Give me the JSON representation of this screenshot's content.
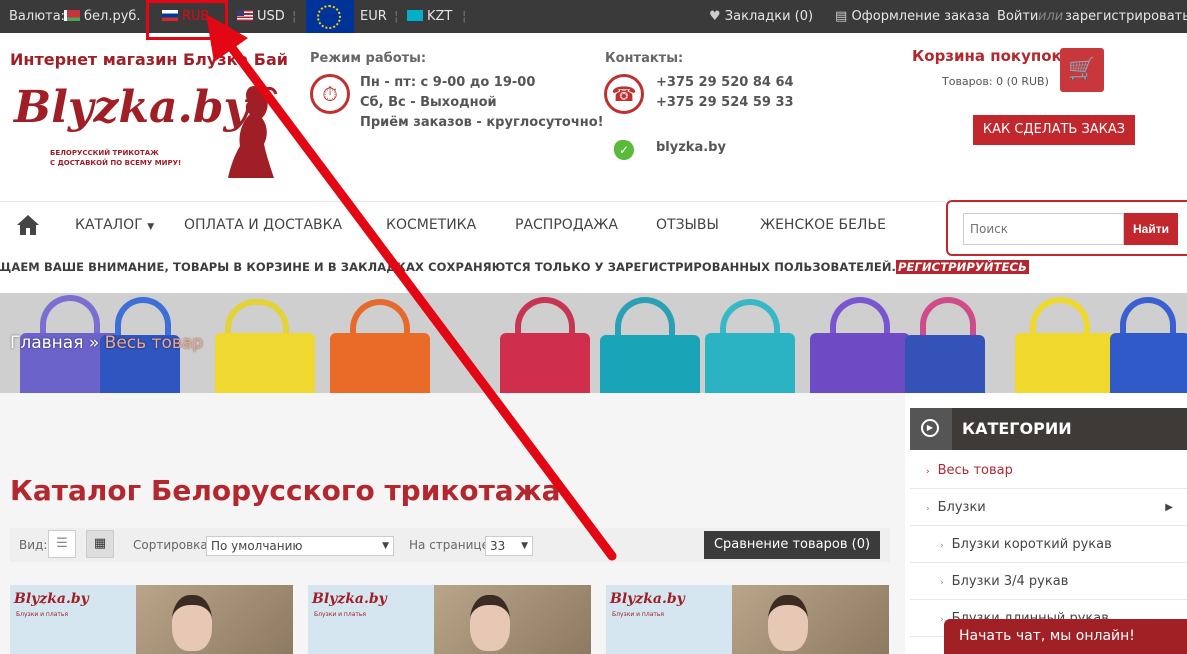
{
  "topbar": {
    "currency_label": "Валюта:",
    "currencies": [
      "бел.руб.",
      "RUB",
      "USD",
      "EUR",
      "KZT"
    ],
    "bookmarks": "Закладки (0)",
    "checkout": "Оформление заказа",
    "login": "Войти",
    "or": "или",
    "register": "зарегистрироваться"
  },
  "header": {
    "shop_name": "Интернет магазин Блузка Бай",
    "logo_text": "Blyzka.by",
    "logo_tagline_1": "БЕЛОРУССКИЙ ТРИКОТАЖ",
    "logo_tagline_2": "С ДОСТАВКОЙ ПО ВСЕМУ МИРУ!",
    "hours_title": "Режим работы:",
    "hours_lines": [
      "Пн - пт: с 9-00 до 19-00",
      "Сб, Вс - Выходной",
      "Приём заказов - круглосуточно!"
    ],
    "contacts_title": "Контакты:",
    "phones": [
      "+375 29 520 84 64",
      "+375 29 524 59 33"
    ],
    "site": "blyzka.by",
    "cart_title": "Корзина покупок",
    "cart_summary": "Товаров: 0 (0 RUB)",
    "how_to_order": "КАК СДЕЛАТЬ ЗАКАЗ"
  },
  "nav": {
    "items": [
      "КАТАЛОГ",
      "ОПЛАТА И ДОСТАВКА",
      "КОСМЕТИКА",
      "РАСПРОДАЖА",
      "ОТЗЫВЫ",
      "ЖЕНСКОЕ БЕЛЬЕ"
    ],
    "search_placeholder": "Поиск",
    "search_button": "Найти"
  },
  "notice": {
    "text": "ЩАЕМ ВАШЕ ВНИМАНИЕ, ТОВАРЫ В КОРЗИНЕ И В ЗАКЛАДКАХ СОХРАНЯЮТСЯ ТОЛЬКО У ЗАРЕГИСТРИРОВАННЫХ ПОЛЬЗОВАТЕЛЕЙ.",
    "link": "РЕГИСТРИРУЙТЕСЬ"
  },
  "breadcrumb": {
    "home": "Главная",
    "separator": "»",
    "current": "Весь товар"
  },
  "catalog": {
    "title": "Каталог Белорусского трикотажа",
    "view_label": "Вид:",
    "sort_label": "Сортировка:",
    "sort_value": "По умолчанию",
    "per_page_label": "На странице:",
    "per_page_value": "33",
    "compare": "Сравнение товаров (0)"
  },
  "products": [
    {
      "logo": "Blyzka.by",
      "tag": "Блузки и платья"
    },
    {
      "logo": "Blyzka.by",
      "tag": "Блузки и платья"
    },
    {
      "logo": "Blyzka.by",
      "tag": "Блузки и платья"
    }
  ],
  "sidebar": {
    "title": "КАТЕГОРИИ",
    "items": [
      "Весь товар",
      "Блузки",
      "Блузки короткий рукав",
      "Блузки 3/4 рукав",
      "Блузки длинный рукав"
    ]
  },
  "chat": {
    "label": "Начать чат, мы онлайн!"
  },
  "colors": {
    "brand": "#b3282e",
    "annotation": "#e30613",
    "topbar": "#3a3a3a"
  },
  "icons": [
    "heart-icon",
    "checkout-icon",
    "clock-icon",
    "phone-icon",
    "viber-icon",
    "cart-icon",
    "home-icon",
    "list-view-icon",
    "grid-view-icon",
    "play-circle-icon"
  ]
}
